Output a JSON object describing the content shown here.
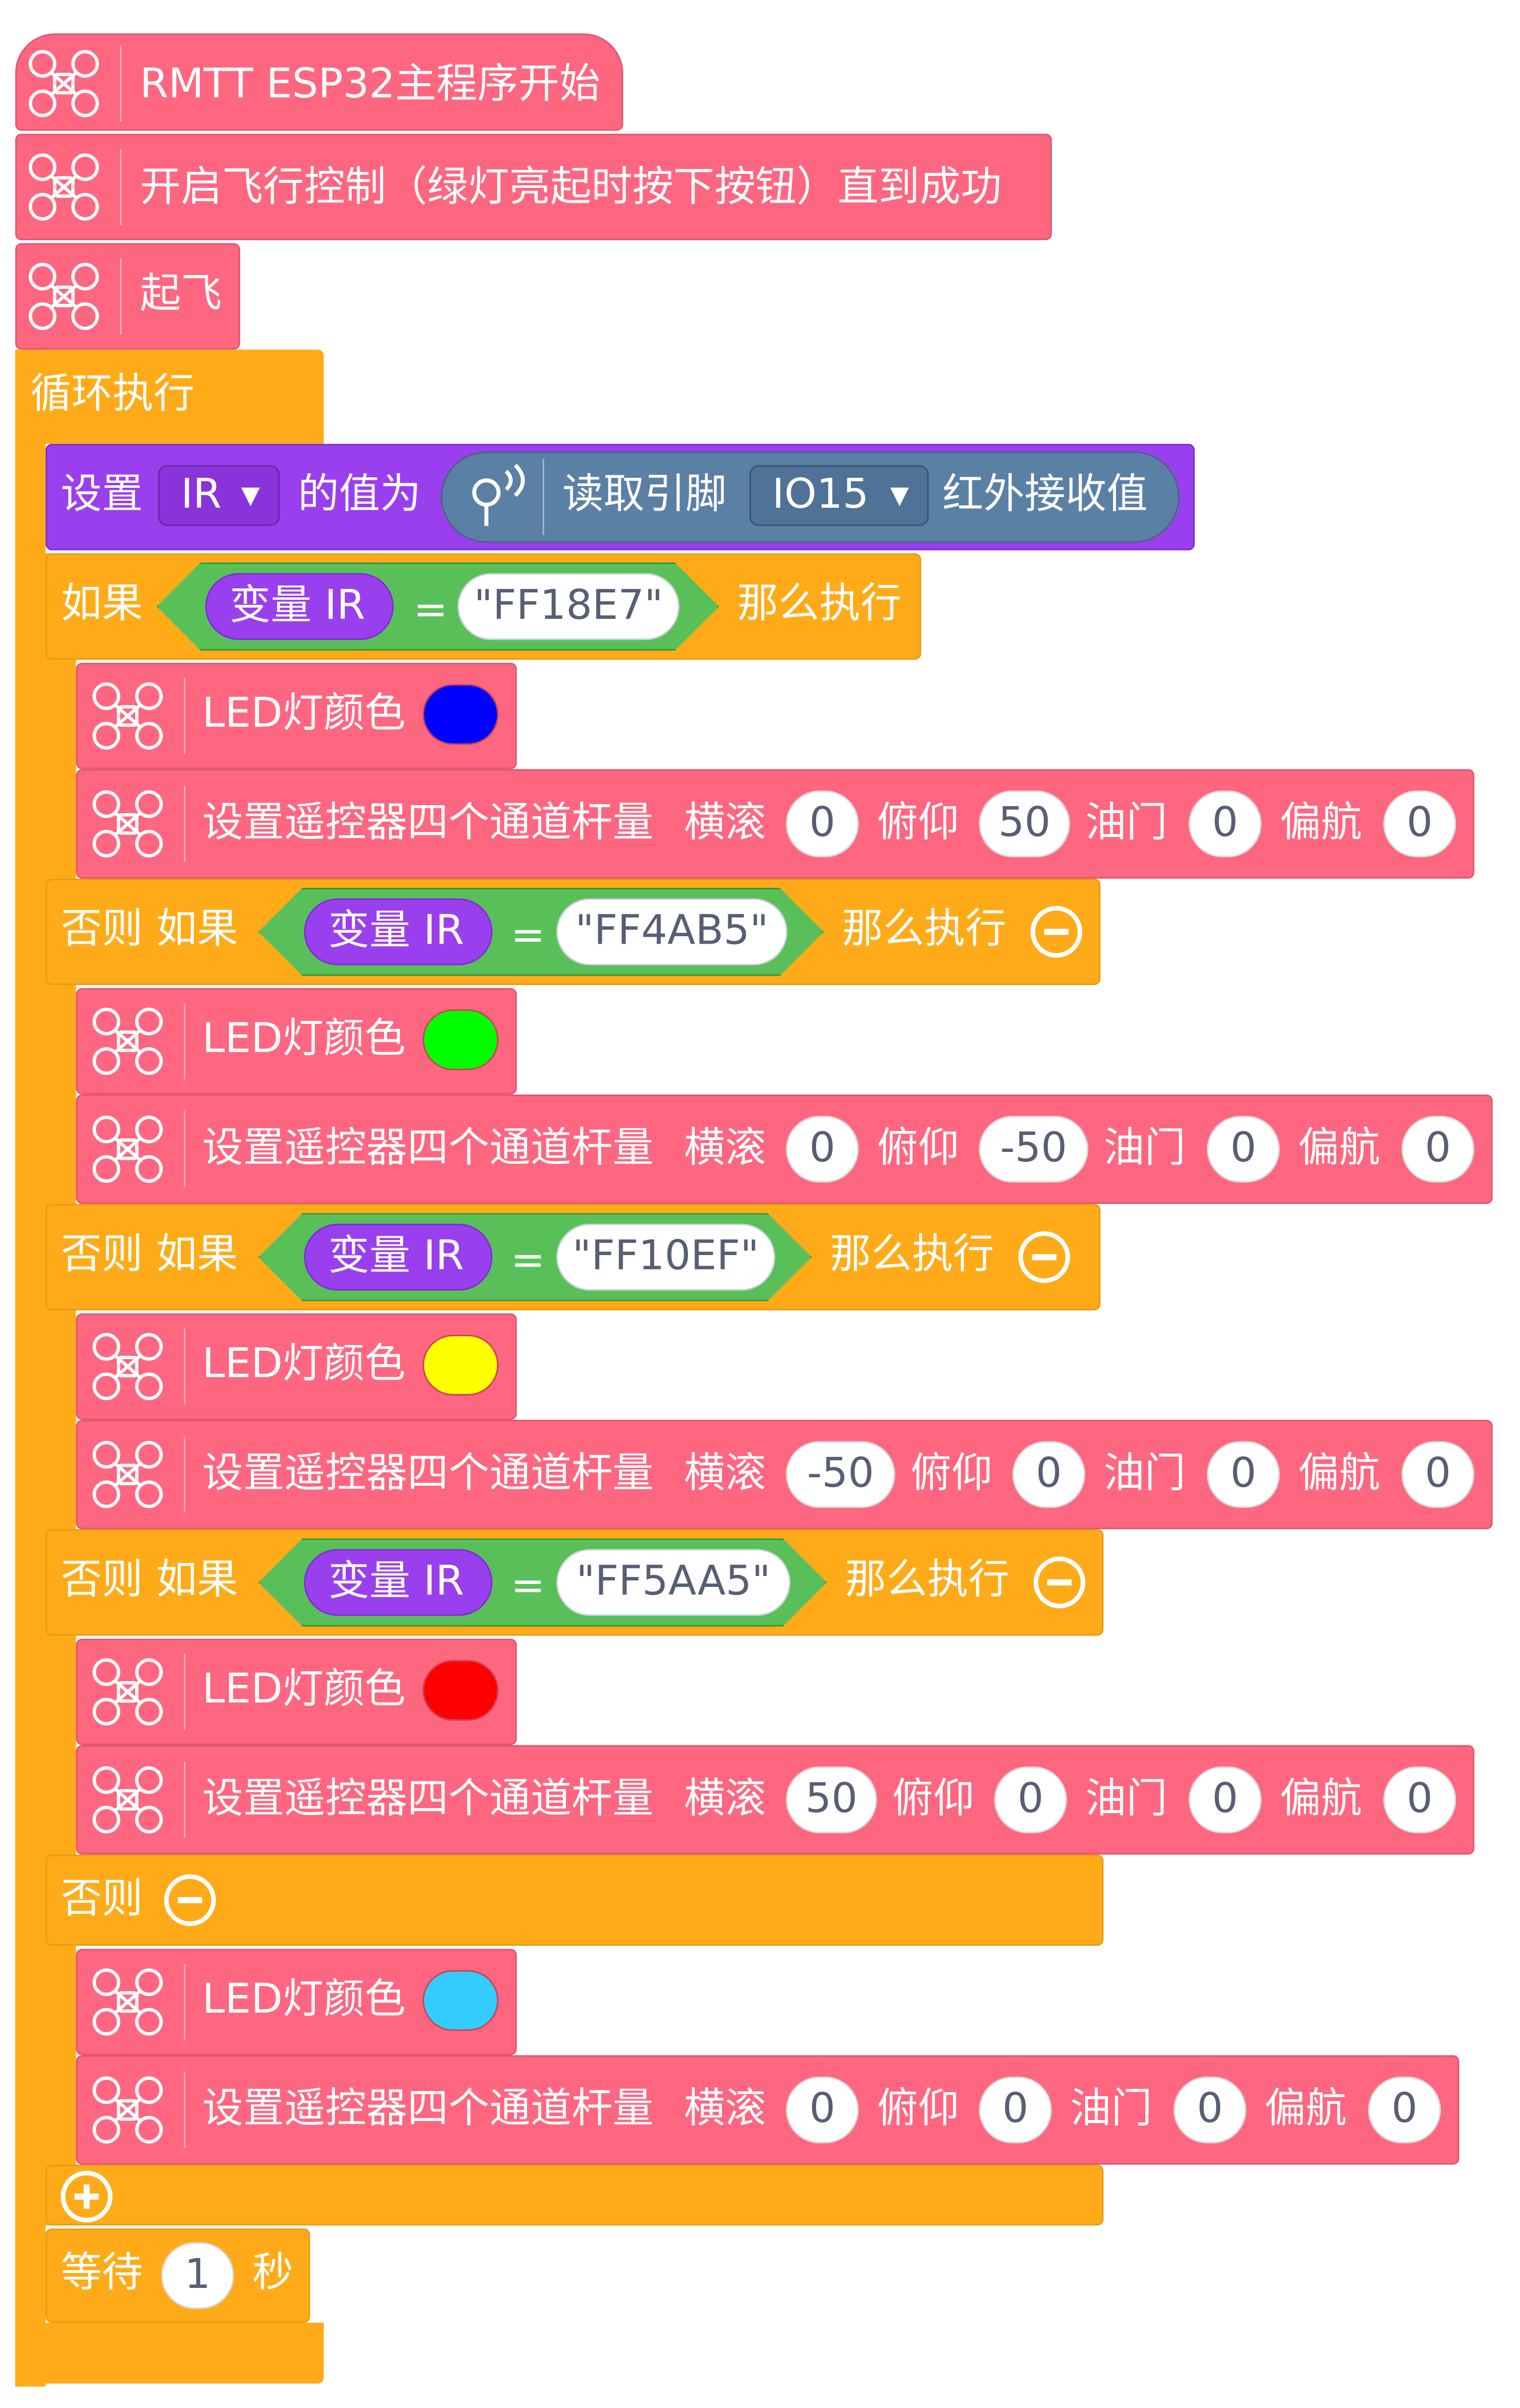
{
  "blocks": {
    "program_start": "RMTT ESP32主程序开始",
    "enable_flight_control": "开启飞行控制（绿灯亮起时按下按钮）直到成功",
    "takeoff": "起飞",
    "forever_loop": "循环执行",
    "set_variable": {
      "label_set": "设置",
      "var_name": "IR",
      "label_value": "的值为",
      "read_pin_label": "读取引脚",
      "pin": "IO15",
      "ir_label": "红外接收值"
    },
    "if_label": "如果",
    "elseif_label": "否则 如果",
    "else_label": "否则",
    "then_label": "那么执行",
    "var_label": "变量 IR",
    "eq_sign": "=",
    "led_label": "LED灯颜色",
    "rc": {
      "label": "设置遥控器四个通道杆量",
      "roll": "横滚",
      "pitch": "俯仰",
      "throttle": "油门",
      "yaw": "偏航"
    },
    "branches": [
      {
        "code": "\"FF18E7\"",
        "color": "#0000FF",
        "roll": "0",
        "pitch": "50",
        "throttle": "0",
        "yaw": "0"
      },
      {
        "code": "\"FF4AB5\"",
        "color": "#00FF00",
        "roll": "0",
        "pitch": "-50",
        "throttle": "0",
        "yaw": "0"
      },
      {
        "code": "\"FF10EF\"",
        "color": "#FFFF00",
        "roll": "-50",
        "pitch": "0",
        "throttle": "0",
        "yaw": "0"
      },
      {
        "code": "\"FF5AA5\"",
        "color": "#FF0000",
        "roll": "50",
        "pitch": "0",
        "throttle": "0",
        "yaw": "0"
      }
    ],
    "else_branch": {
      "color": "#33CCFF",
      "roll": "0",
      "pitch": "0",
      "throttle": "0",
      "yaw": "0"
    },
    "wait": {
      "label": "等待",
      "value": "1",
      "unit": "秒"
    }
  },
  "colors": {
    "pink": "#FF6680",
    "orange": "#FFAB19",
    "purple": "#9A3FEE",
    "green": "#59C059",
    "teal": "#5B80A5"
  },
  "icons": {
    "drone": "drone-icon",
    "ir_sensor": "ir-sensor-icon",
    "minus": "minus-circle-icon",
    "plus": "plus-circle-icon"
  }
}
